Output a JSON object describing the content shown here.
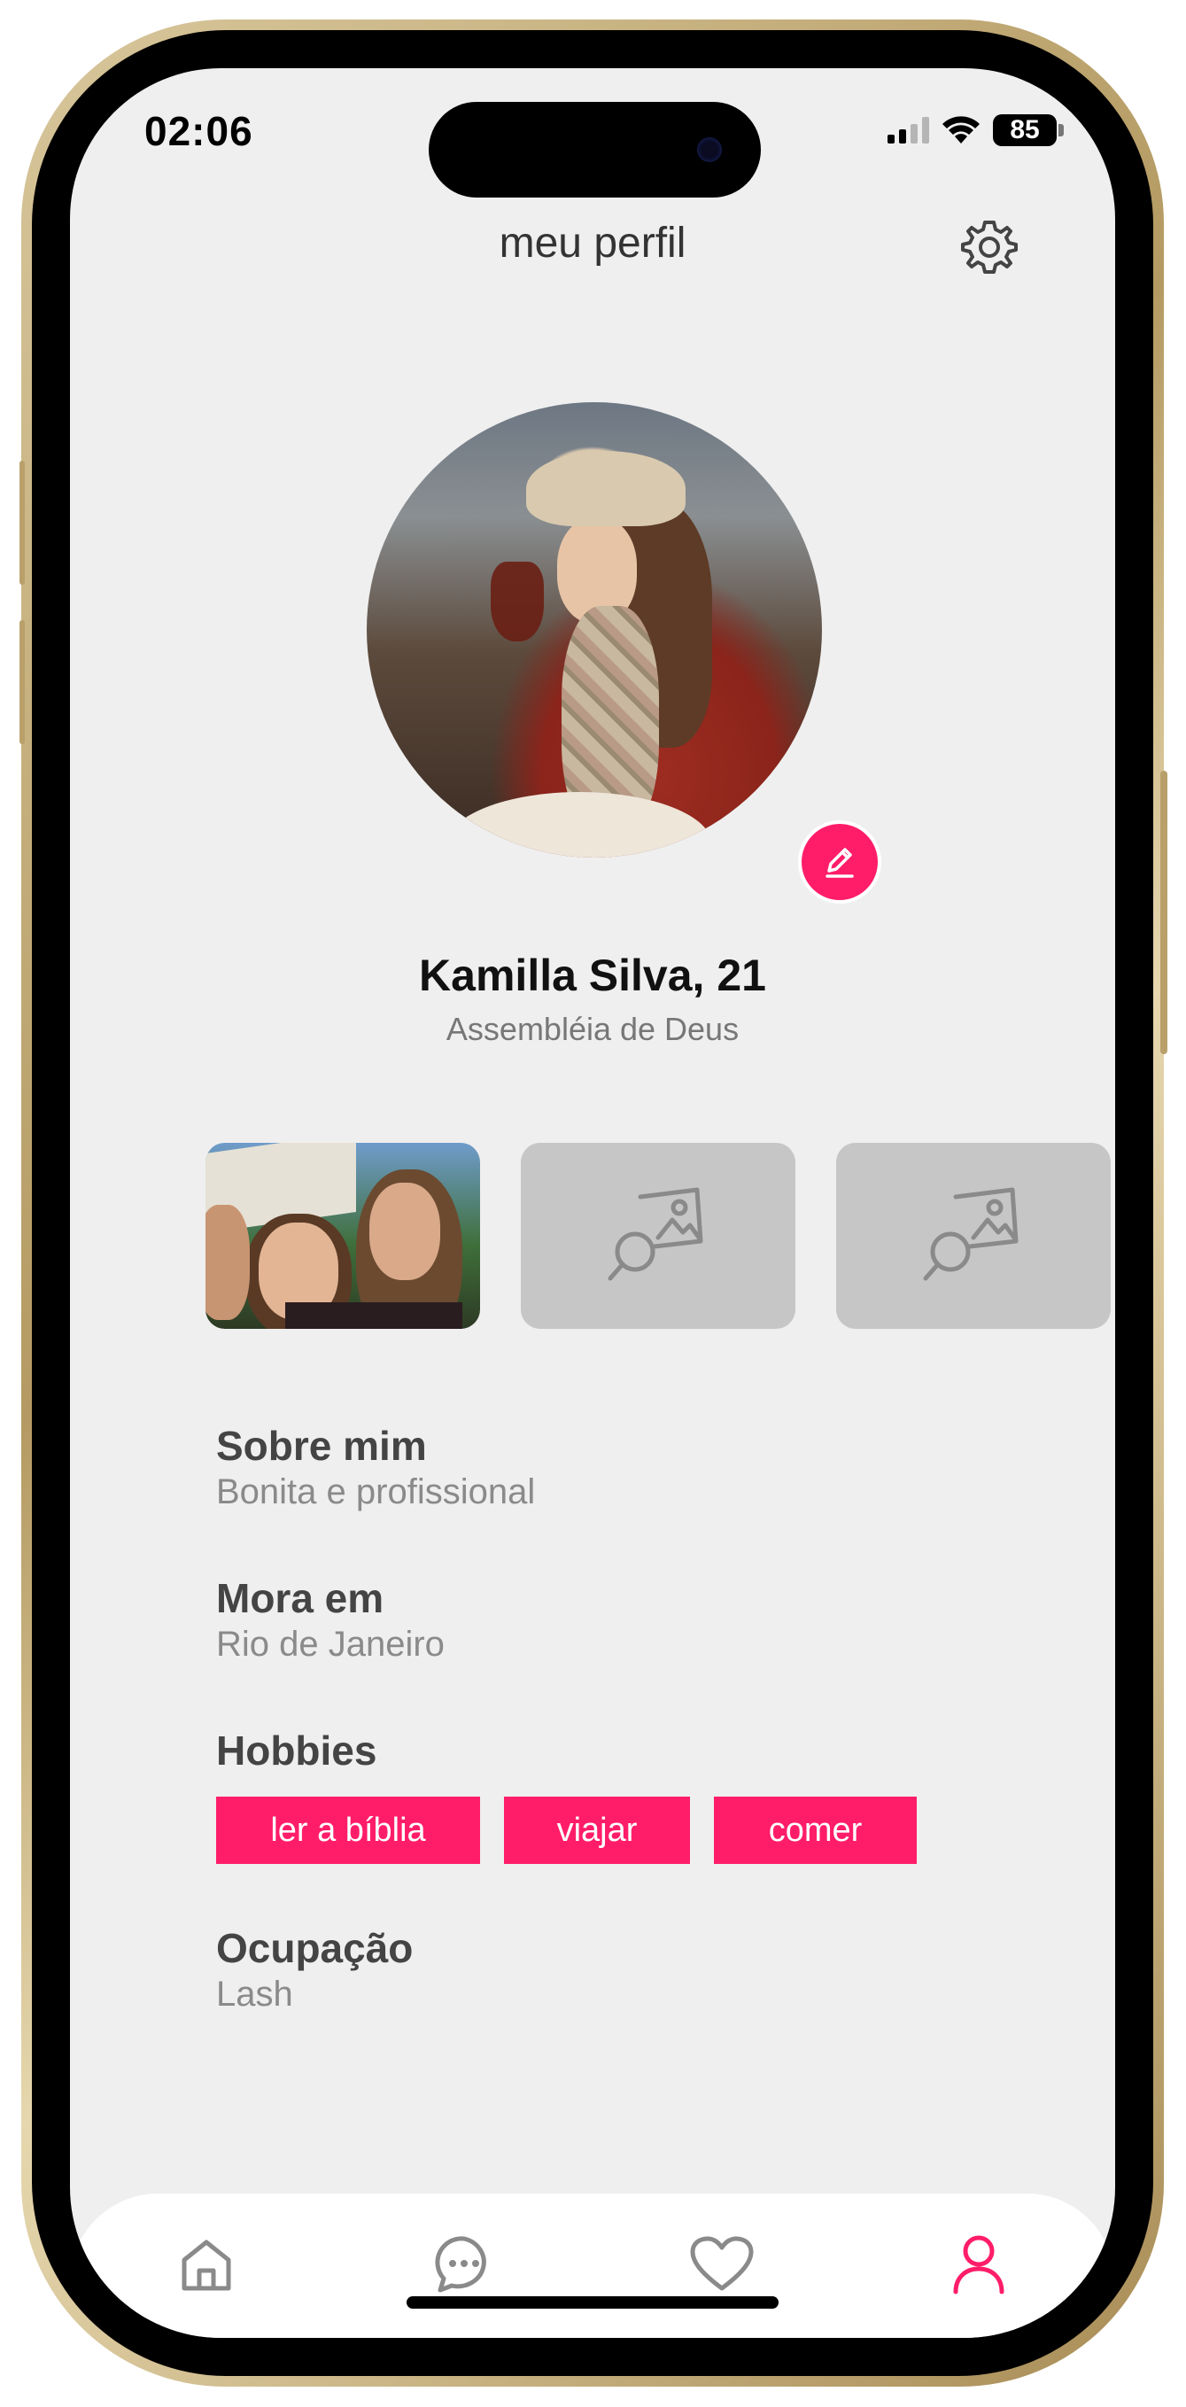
{
  "status_bar": {
    "time": "02:06",
    "battery": "85"
  },
  "header": {
    "title": "meu perfil"
  },
  "profile": {
    "name": "Kamilla Silva, 21",
    "church": "Assembléia de Deus"
  },
  "gallery": {
    "slots": [
      "photo",
      "empty",
      "empty"
    ]
  },
  "sections": {
    "about_label": "Sobre mim",
    "about_value": "Bonita e profissional",
    "location_label": "Mora em",
    "location_value": "Rio de Janeiro",
    "hobbies_label": "Hobbies",
    "hobbies": [
      "ler a bíblia",
      "viajar",
      "comer"
    ],
    "occupation_label": "Ocupação",
    "occupation_value": "Lash"
  },
  "tabbar": {
    "items": [
      {
        "icon": "home-icon",
        "active": false
      },
      {
        "icon": "chat-icon",
        "active": false
      },
      {
        "icon": "heart-icon",
        "active": false
      },
      {
        "icon": "profile-icon",
        "active": true
      }
    ]
  },
  "colors": {
    "accent": "#ff1d6a",
    "background": "#efefef",
    "placeholder": "#c6c6c6"
  }
}
